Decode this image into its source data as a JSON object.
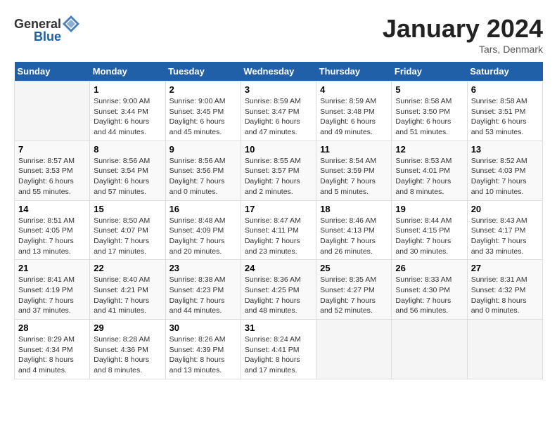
{
  "header": {
    "logo_general": "General",
    "logo_blue": "Blue",
    "month_title": "January 2024",
    "subtitle": "Tars, Denmark"
  },
  "calendar": {
    "days_of_week": [
      "Sunday",
      "Monday",
      "Tuesday",
      "Wednesday",
      "Thursday",
      "Friday",
      "Saturday"
    ],
    "weeks": [
      [
        {
          "day": "",
          "info": ""
        },
        {
          "day": "1",
          "info": "Sunrise: 9:00 AM\nSunset: 3:44 PM\nDaylight: 6 hours\nand 44 minutes."
        },
        {
          "day": "2",
          "info": "Sunrise: 9:00 AM\nSunset: 3:45 PM\nDaylight: 6 hours\nand 45 minutes."
        },
        {
          "day": "3",
          "info": "Sunrise: 8:59 AM\nSunset: 3:47 PM\nDaylight: 6 hours\nand 47 minutes."
        },
        {
          "day": "4",
          "info": "Sunrise: 8:59 AM\nSunset: 3:48 PM\nDaylight: 6 hours\nand 49 minutes."
        },
        {
          "day": "5",
          "info": "Sunrise: 8:58 AM\nSunset: 3:50 PM\nDaylight: 6 hours\nand 51 minutes."
        },
        {
          "day": "6",
          "info": "Sunrise: 8:58 AM\nSunset: 3:51 PM\nDaylight: 6 hours\nand 53 minutes."
        }
      ],
      [
        {
          "day": "7",
          "info": "Sunrise: 8:57 AM\nSunset: 3:53 PM\nDaylight: 6 hours\nand 55 minutes."
        },
        {
          "day": "8",
          "info": "Sunrise: 8:56 AM\nSunset: 3:54 PM\nDaylight: 6 hours\nand 57 minutes."
        },
        {
          "day": "9",
          "info": "Sunrise: 8:56 AM\nSunset: 3:56 PM\nDaylight: 7 hours\nand 0 minutes."
        },
        {
          "day": "10",
          "info": "Sunrise: 8:55 AM\nSunset: 3:57 PM\nDaylight: 7 hours\nand 2 minutes."
        },
        {
          "day": "11",
          "info": "Sunrise: 8:54 AM\nSunset: 3:59 PM\nDaylight: 7 hours\nand 5 minutes."
        },
        {
          "day": "12",
          "info": "Sunrise: 8:53 AM\nSunset: 4:01 PM\nDaylight: 7 hours\nand 8 minutes."
        },
        {
          "day": "13",
          "info": "Sunrise: 8:52 AM\nSunset: 4:03 PM\nDaylight: 7 hours\nand 10 minutes."
        }
      ],
      [
        {
          "day": "14",
          "info": "Sunrise: 8:51 AM\nSunset: 4:05 PM\nDaylight: 7 hours\nand 13 minutes."
        },
        {
          "day": "15",
          "info": "Sunrise: 8:50 AM\nSunset: 4:07 PM\nDaylight: 7 hours\nand 17 minutes."
        },
        {
          "day": "16",
          "info": "Sunrise: 8:48 AM\nSunset: 4:09 PM\nDaylight: 7 hours\nand 20 minutes."
        },
        {
          "day": "17",
          "info": "Sunrise: 8:47 AM\nSunset: 4:11 PM\nDaylight: 7 hours\nand 23 minutes."
        },
        {
          "day": "18",
          "info": "Sunrise: 8:46 AM\nSunset: 4:13 PM\nDaylight: 7 hours\nand 26 minutes."
        },
        {
          "day": "19",
          "info": "Sunrise: 8:44 AM\nSunset: 4:15 PM\nDaylight: 7 hours\nand 30 minutes."
        },
        {
          "day": "20",
          "info": "Sunrise: 8:43 AM\nSunset: 4:17 PM\nDaylight: 7 hours\nand 33 minutes."
        }
      ],
      [
        {
          "day": "21",
          "info": "Sunrise: 8:41 AM\nSunset: 4:19 PM\nDaylight: 7 hours\nand 37 minutes."
        },
        {
          "day": "22",
          "info": "Sunrise: 8:40 AM\nSunset: 4:21 PM\nDaylight: 7 hours\nand 41 minutes."
        },
        {
          "day": "23",
          "info": "Sunrise: 8:38 AM\nSunset: 4:23 PM\nDaylight: 7 hours\nand 44 minutes."
        },
        {
          "day": "24",
          "info": "Sunrise: 8:36 AM\nSunset: 4:25 PM\nDaylight: 7 hours\nand 48 minutes."
        },
        {
          "day": "25",
          "info": "Sunrise: 8:35 AM\nSunset: 4:27 PM\nDaylight: 7 hours\nand 52 minutes."
        },
        {
          "day": "26",
          "info": "Sunrise: 8:33 AM\nSunset: 4:30 PM\nDaylight: 7 hours\nand 56 minutes."
        },
        {
          "day": "27",
          "info": "Sunrise: 8:31 AM\nSunset: 4:32 PM\nDaylight: 8 hours\nand 0 minutes."
        }
      ],
      [
        {
          "day": "28",
          "info": "Sunrise: 8:29 AM\nSunset: 4:34 PM\nDaylight: 8 hours\nand 4 minutes."
        },
        {
          "day": "29",
          "info": "Sunrise: 8:28 AM\nSunset: 4:36 PM\nDaylight: 8 hours\nand 8 minutes."
        },
        {
          "day": "30",
          "info": "Sunrise: 8:26 AM\nSunset: 4:39 PM\nDaylight: 8 hours\nand 13 minutes."
        },
        {
          "day": "31",
          "info": "Sunrise: 8:24 AM\nSunset: 4:41 PM\nDaylight: 8 hours\nand 17 minutes."
        },
        {
          "day": "",
          "info": ""
        },
        {
          "day": "",
          "info": ""
        },
        {
          "day": "",
          "info": ""
        }
      ]
    ]
  }
}
